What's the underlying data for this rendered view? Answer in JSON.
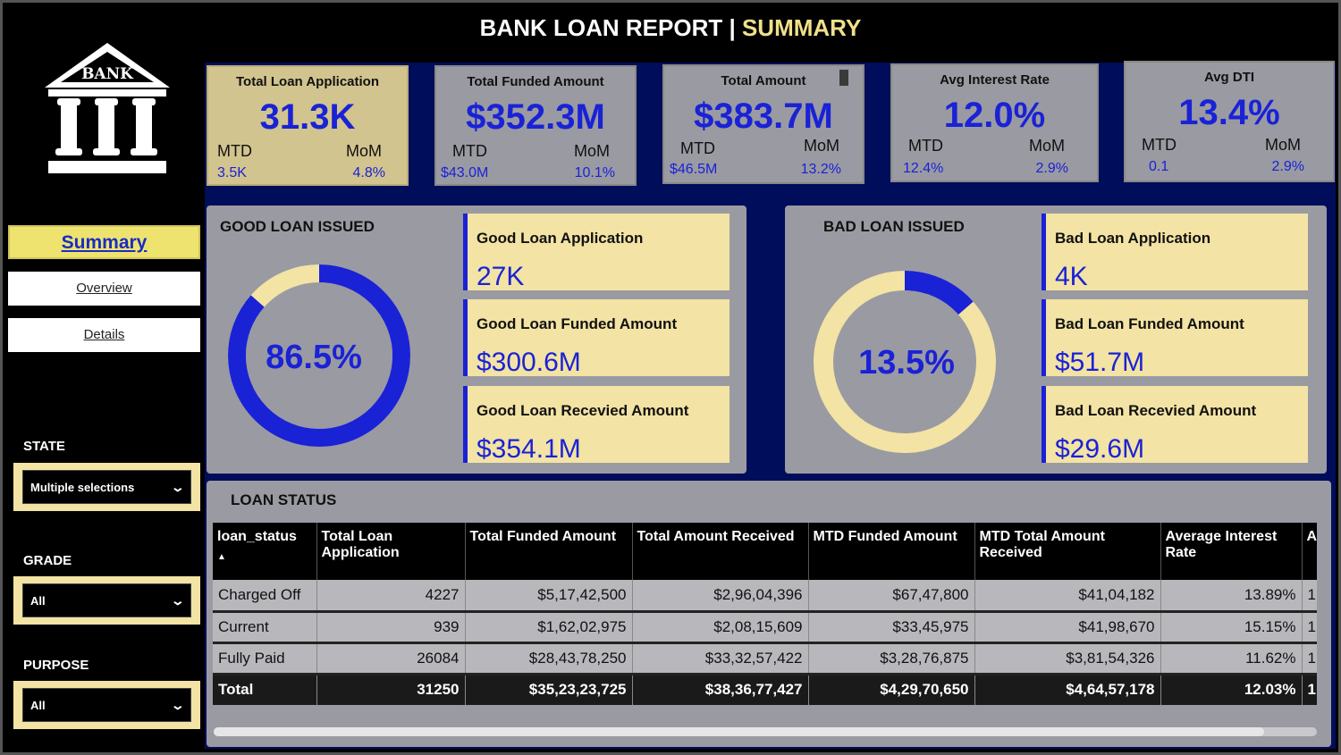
{
  "header": {
    "title_main": "BANK LOAN REPORT | ",
    "title_accent": "SUMMARY"
  },
  "logo": {
    "text": "BANK"
  },
  "nav": {
    "items": [
      {
        "label": "Summary",
        "active": true
      },
      {
        "label": "Overview",
        "active": false
      },
      {
        "label": "Details",
        "active": false
      }
    ]
  },
  "filters": [
    {
      "label": "STATE",
      "value": "Multiple selections"
    },
    {
      "label": "GRADE",
      "value": "All"
    },
    {
      "label": "PURPOSE",
      "value": "All"
    }
  ],
  "kpis": [
    {
      "title": "Total Loan Application",
      "value": "31.3K",
      "mtd_label": "MTD",
      "mtd": "3.5K",
      "mom_label": "MoM",
      "mom": "4.8%"
    },
    {
      "title": "Total Funded Amount",
      "value": "$352.3M",
      "mtd_label": "MTD",
      "mtd": "$43.0M",
      "mom_label": "MoM",
      "mom": "10.1%"
    },
    {
      "title": "Total Amount",
      "value": "$383.7M",
      "mtd_label": "MTD",
      "mtd": "$46.5M",
      "mom_label": "MoM",
      "mom": "13.2%"
    },
    {
      "title": "Avg Interest Rate",
      "value": "12.0%",
      "mtd_label": "MTD",
      "mtd": "12.4%",
      "mom_label": "MoM",
      "mom": "2.9%"
    },
    {
      "title": "Avg DTI",
      "value": "13.4%",
      "mtd_label": "MTD",
      "mtd": "0.1",
      "mom_label": "MoM",
      "mom": "2.9%"
    }
  ],
  "good_loan": {
    "heading": "GOOD LOAN ISSUED",
    "percent_label": "86.5%",
    "percent": 0.865,
    "stats": [
      {
        "label": "Good Loan Application",
        "value": "27K"
      },
      {
        "label": "Good Loan Funded Amount",
        "value": "$300.6M"
      },
      {
        "label": "Good Loan Recevied Amount",
        "value": "$354.1M"
      }
    ]
  },
  "bad_loan": {
    "heading": "BAD LOAN ISSUED",
    "percent_label": "13.5%",
    "percent": 0.135,
    "stats": [
      {
        "label": "Bad Loan Application",
        "value": "4K"
      },
      {
        "label": "Bad Loan Funded Amount",
        "value": "$51.7M"
      },
      {
        "label": "Bad Loan Recevied Amount",
        "value": "$29.6M"
      }
    ]
  },
  "colors": {
    "donut_fill": "#1a22d6",
    "donut_rest": "#f3e3a4",
    "accent": "#f0e08a"
  },
  "loan_status": {
    "heading": "LOAN STATUS",
    "columns": [
      "loan_status",
      "Total Loan Application",
      "Total Funded Amount",
      "Total Amount Received",
      "MTD Funded Amount",
      "MTD Total Amount Received",
      "Average Interest Rate",
      "A"
    ],
    "rows": [
      [
        "Charged Off",
        "4227",
        "$5,17,42,500",
        "$2,96,04,396",
        "$67,47,800",
        "$41,04,182",
        "13.89%",
        "1"
      ],
      [
        "Current",
        "939",
        "$1,62,02,975",
        "$2,08,15,609",
        "$33,45,975",
        "$41,98,670",
        "15.15%",
        "1"
      ],
      [
        "Fully Paid",
        "26084",
        "$28,43,78,250",
        "$33,32,57,422",
        "$3,28,76,875",
        "$3,81,54,326",
        "11.62%",
        "1"
      ]
    ],
    "total": [
      "Total",
      "31250",
      "$35,23,23,725",
      "$38,36,77,427",
      "$4,29,70,650",
      "$4,64,57,178",
      "12.03%",
      "1"
    ]
  }
}
